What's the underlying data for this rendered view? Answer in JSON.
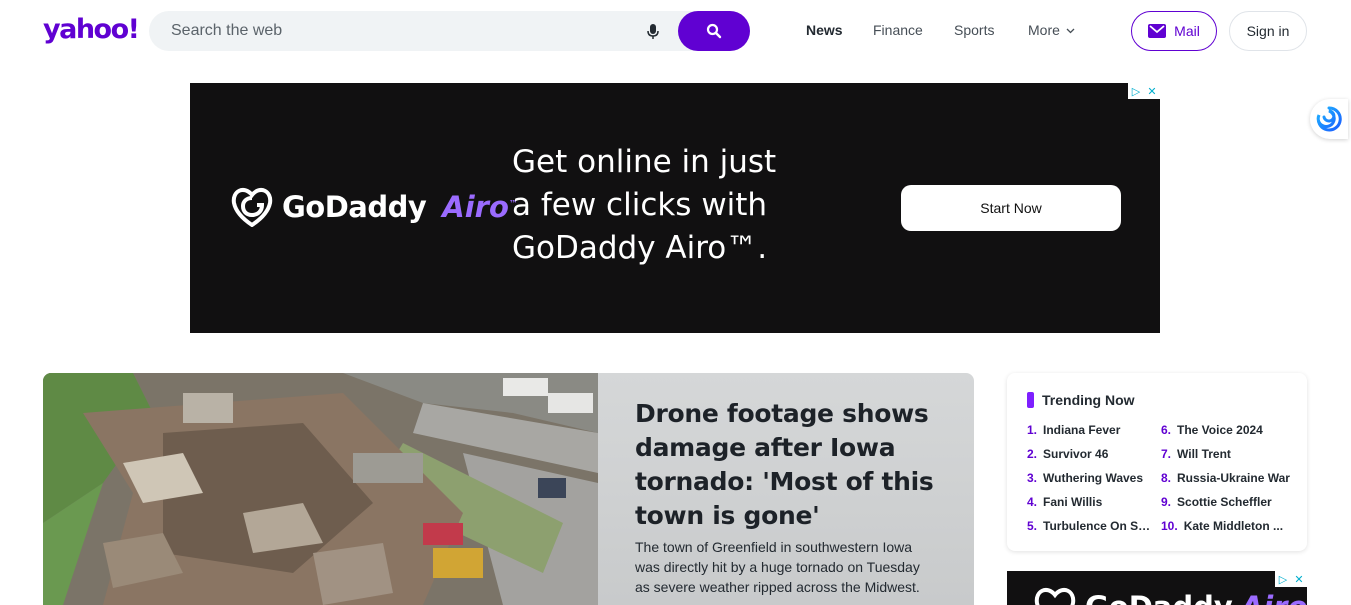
{
  "header": {
    "logo": "yahoo!",
    "search_placeholder": "Search the web",
    "nav": [
      {
        "label": "News",
        "active": true
      },
      {
        "label": "Finance",
        "active": false
      },
      {
        "label": "Sports",
        "active": false
      },
      {
        "label": "More",
        "active": false
      }
    ],
    "mail_label": "Mail",
    "signin_label": "Sign in"
  },
  "ad": {
    "brand": "GoDaddy",
    "brand_product": "Airo",
    "brand_product_mark": "™",
    "headline_1": "Get online in just",
    "headline_2": "a few clicks with",
    "headline_3": "GoDaddy Airo",
    "headline_mark": "™.",
    "cta": "Start Now"
  },
  "hero": {
    "title": "Drone footage shows damage after Iowa tornado: 'Most of this town is gone'",
    "description": "The town of Greenfield in southwestern Iowa was directly hit by a huge tornado on Tuesday as severe weather ripped across the Midwest."
  },
  "trending": {
    "title": "Trending Now",
    "items": [
      {
        "num": "1.",
        "label": "Indiana Fever"
      },
      {
        "num": "2.",
        "label": "Survivor 46"
      },
      {
        "num": "3.",
        "label": "Wuthering Waves"
      },
      {
        "num": "4.",
        "label": "Fani Willis"
      },
      {
        "num": "5.",
        "label": "Turbulence On Si..."
      },
      {
        "num": "6.",
        "label": "The Voice 2024"
      },
      {
        "num": "7.",
        "label": "Will Trent"
      },
      {
        "num": "8.",
        "label": "Russia-Ukraine War"
      },
      {
        "num": "9.",
        "label": "Scottie Scheffler"
      },
      {
        "num": "10.",
        "label": "Kate Middleton ..."
      }
    ]
  },
  "colors": {
    "brand": "#6001d2",
    "trending_bar": "#7e1fff",
    "ad_bg": "#111011",
    "ad_accent": "#9b6bff"
  },
  "icons": [
    "mic-icon",
    "search-icon",
    "chevron-down-icon",
    "mail-icon",
    "adchoices-icon",
    "close-icon",
    "extension-icon",
    "godaddy-logo-icon"
  ]
}
